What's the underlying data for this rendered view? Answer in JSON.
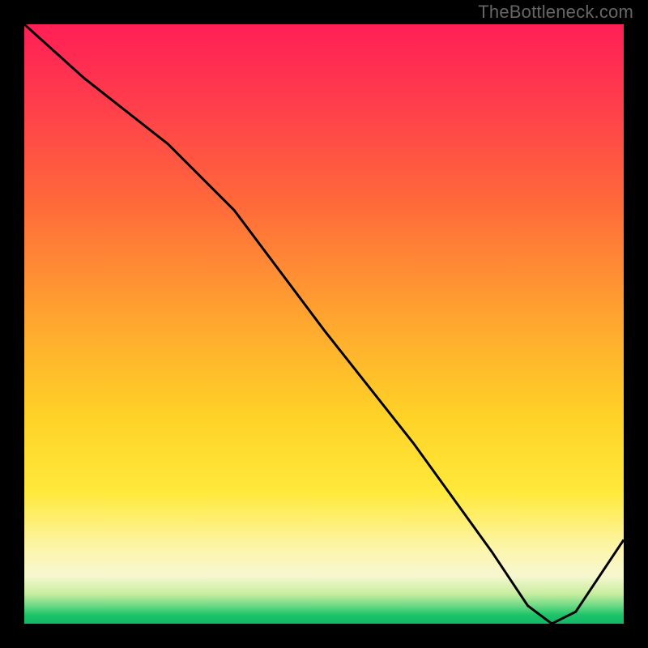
{
  "watermark": "TheBottleneck.com",
  "bottom_label": "",
  "chart_data": {
    "type": "line",
    "title": "",
    "xlabel": "",
    "ylabel": "",
    "xlim": [
      0,
      100
    ],
    "ylim": [
      0,
      100
    ],
    "series": [
      {
        "name": "curve",
        "x": [
          0,
          10,
          24,
          35,
          50,
          65,
          78,
          84,
          88,
          92,
          100
        ],
        "y": [
          100,
          91,
          80,
          69,
          49,
          30,
          12,
          3,
          0,
          2,
          14
        ]
      }
    ],
    "gradient_stops": [
      {
        "pos": 0.0,
        "color": "#ff1f55"
      },
      {
        "pos": 0.5,
        "color": "#ffa82f"
      },
      {
        "pos": 0.8,
        "color": "#ffe93a"
      },
      {
        "pos": 0.95,
        "color": "#c8eea0"
      },
      {
        "pos": 1.0,
        "color": "#11b765"
      }
    ],
    "marker": {
      "x": 88,
      "y": 0,
      "label": ""
    }
  }
}
